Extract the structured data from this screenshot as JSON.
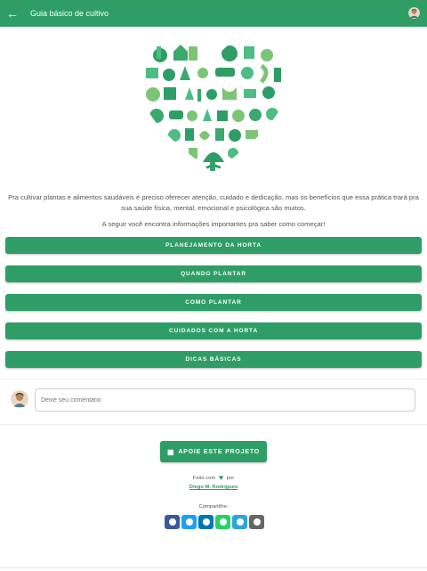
{
  "app_bar": {
    "title": "Guia básico de cultivo",
    "back_icon": "arrow-left-icon",
    "avatar_icon": "user-avatar-icon",
    "color": "#2e9e66"
  },
  "hero_icon": "gardening-heart-illustration",
  "intro": {
    "paragraph": "Pra cultivar plantas e alimentos saudáveis é preciso oferecer atenção, cuidado e dedicação, mas os benefícios que essa prática trará pra sua saúde física, mental, emocional e psicológica são muitos.",
    "follow_up": "A seguir você encontra informações importantes pra saber como começar!"
  },
  "menu": [
    {
      "label": "PLANEJAMENTO DA HORTA"
    },
    {
      "label": "QUANDO PLANTAR"
    },
    {
      "label": "COMO PLANTAR"
    },
    {
      "label": "CUIDADOS COM A HORTA"
    },
    {
      "label": "DICAS BÁSICAS"
    }
  ],
  "comment": {
    "placeholder": "Deixe seu comentário",
    "avatar_icon": "user-avatar-icon"
  },
  "support": {
    "label": "APOIE ESTE PROJETO",
    "icon": "donate-icon"
  },
  "credits": {
    "made_with": "Feito com",
    "by": "por",
    "heart_icon": "heart-icon",
    "author": "Diego M. Rodrigues"
  },
  "share": {
    "label": "Compartilhe:",
    "buttons": [
      {
        "icon": "facebook-icon",
        "color": "#3b5998"
      },
      {
        "icon": "twitter-icon",
        "color": "#1da1f2"
      },
      {
        "icon": "linkedin-icon",
        "color": "#0077b5"
      },
      {
        "icon": "whatsapp-icon",
        "color": "#25d366"
      },
      {
        "icon": "telegram-icon",
        "color": "#2ca5e0"
      },
      {
        "icon": "email-icon",
        "color": "#666666"
      }
    ]
  }
}
